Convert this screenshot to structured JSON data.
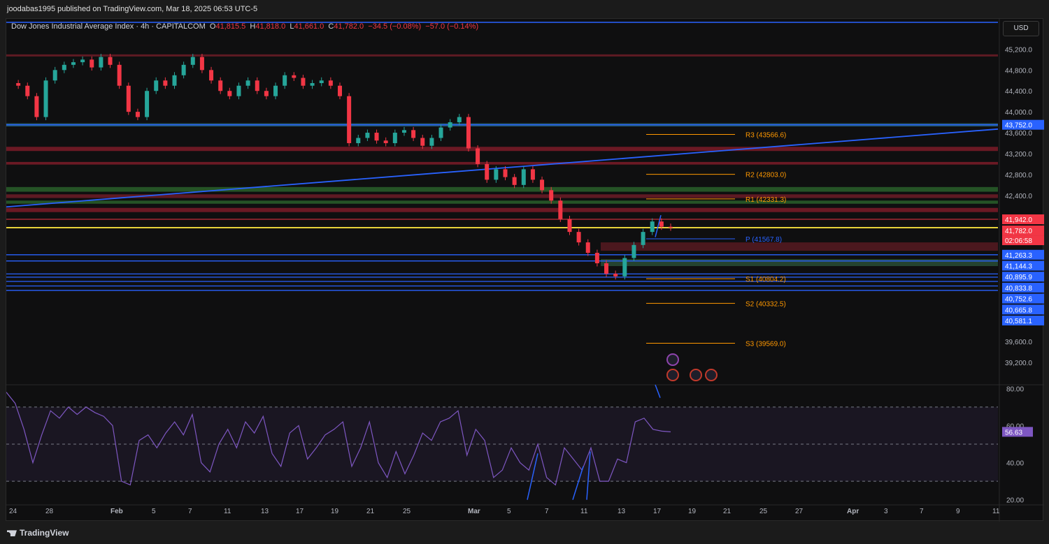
{
  "header": {
    "publish_line": "joodabas1995 published on TradingView.com, Mar 18, 2025 06:53 UTC-5"
  },
  "legend": {
    "symbol": "Dow Jones Industrial Average Index · 4h · CAPITALCOM",
    "o_label": "O",
    "o_value": "41,815.5",
    "h_label": "H",
    "h_value": "41,818.0",
    "l_label": "L",
    "l_value": "41,661.0",
    "c_label": "C",
    "c_value": "41,782.0",
    "change": "−34.5 (−0.08%)",
    "change2": "−57.0 (−0.14%)"
  },
  "currency": "USD",
  "footer": {
    "brand": "TradingView"
  },
  "colors": {
    "up": "#26a69a",
    "down": "#f23645",
    "trend": "#2962ff",
    "pivot_orange": "#ff9800",
    "rsi": "#7e57c2",
    "price_tag": "#f23645",
    "level_tag": "#2962ff"
  },
  "chart_data": {
    "type": "line",
    "title": "Dow Jones Industrial Average Index",
    "timeframe": "4h",
    "x_tick_labels": [
      "24",
      "28",
      "Feb",
      "5",
      "7",
      "11",
      "13",
      "17",
      "19",
      "21",
      "25",
      "Mar",
      "5",
      "7",
      "11",
      "13",
      "17",
      "19",
      "21",
      "25",
      "27",
      "Apr",
      "3",
      "7",
      "9",
      "11"
    ],
    "y_tick_labels": [
      "45,200.0",
      "44,800.0",
      "44,400.0",
      "44,000.0",
      "43,600.0",
      "43,200.0",
      "42,800.0",
      "42,400.0",
      "39,600.0",
      "39,200.0"
    ],
    "ylim": [
      38800,
      45700
    ],
    "series": [
      {
        "values": [
          44550,
          44500,
          44300,
          43900,
          44600,
          44800,
          44900,
          44950,
          45000,
          44850,
          45050,
          44900,
          44500,
          44000,
          43900,
          44400,
          44600,
          44500,
          44700,
          44900,
          45050,
          44800,
          44600,
          44400,
          44300,
          44500,
          44600,
          44400,
          44300,
          44500,
          44700,
          44650,
          44500,
          44550,
          44600,
          44500,
          44300,
          43400,
          43500,
          43600,
          43450,
          43400,
          43600,
          43650,
          43500,
          43350,
          43500,
          43700,
          43800,
          43900,
          43300,
          43000,
          42700,
          42900,
          42750,
          42600,
          42900,
          42700,
          42500,
          42300,
          41950,
          41700,
          41500,
          41300,
          41100,
          40900,
          40850,
          41200,
          41450,
          41700,
          41900,
          41800,
          41782
        ]
      }
    ],
    "current_price": "41,782.0",
    "countdown": "02:06:58",
    "price_labels": [
      {
        "text": "43,752.0",
        "value": 43752,
        "color": "#2962ff"
      },
      {
        "text": "41,942.0",
        "value": 41942,
        "color": "#f23645"
      },
      {
        "text": "41,263.3",
        "value": 41263.3,
        "color": "#2962ff"
      },
      {
        "text": "41,144.3",
        "value": 41144.3,
        "color": "#2962ff"
      },
      {
        "text": "40,895.9",
        "value": 40895.9,
        "color": "#2962ff"
      },
      {
        "text": "40,833.8",
        "value": 40833.8,
        "color": "#2962ff"
      },
      {
        "text": "40,752.6",
        "value": 40752.6,
        "color": "#2962ff"
      },
      {
        "text": "40,665.8",
        "value": 40665.8,
        "color": "#2962ff"
      },
      {
        "text": "40,581.1",
        "value": 40581.1,
        "color": "#2962ff"
      }
    ],
    "pivots": [
      {
        "label": "R3 (43566.6)",
        "value": 43566.6,
        "color": "#ff9800"
      },
      {
        "label": "R2 (42803.0)",
        "value": 42803.0,
        "color": "#ff9800"
      },
      {
        "label": "R1 (42331.3)",
        "value": 42331.3,
        "color": "#ff9800"
      },
      {
        "label": "P (41567.8)",
        "value": 41567.8,
        "color": "#2962ff"
      },
      {
        "label": "S1 (40804.2)",
        "value": 40804.2,
        "color": "#ff9800"
      },
      {
        "label": "S2 (40332.5)",
        "value": 40332.5,
        "color": "#ff9800"
      },
      {
        "label": "S3 (39569.0)",
        "value": 39569.0,
        "color": "#ff9800"
      }
    ],
    "rsi": {
      "current": "56.63",
      "y_tick_labels": [
        "80.00",
        "60.00",
        "40.00",
        "20.00"
      ],
      "ylim": [
        18,
        82
      ],
      "bands": [
        70,
        50,
        30
      ],
      "values": [
        78,
        72,
        58,
        40,
        55,
        68,
        64,
        70,
        66,
        70,
        67,
        65,
        60,
        30,
        28,
        52,
        55,
        48,
        56,
        62,
        55,
        66,
        40,
        35,
        50,
        58,
        48,
        62,
        56,
        65,
        45,
        38,
        56,
        60,
        42,
        48,
        55,
        58,
        62,
        38,
        48,
        62,
        40,
        32,
        46,
        34,
        44,
        56,
        52,
        62,
        64,
        68,
        44,
        58,
        52,
        32,
        36,
        48,
        40,
        36,
        50,
        32,
        28,
        48,
        42,
        36,
        48,
        30,
        30,
        42,
        40,
        62,
        64,
        58,
        57,
        56.63
      ]
    }
  }
}
